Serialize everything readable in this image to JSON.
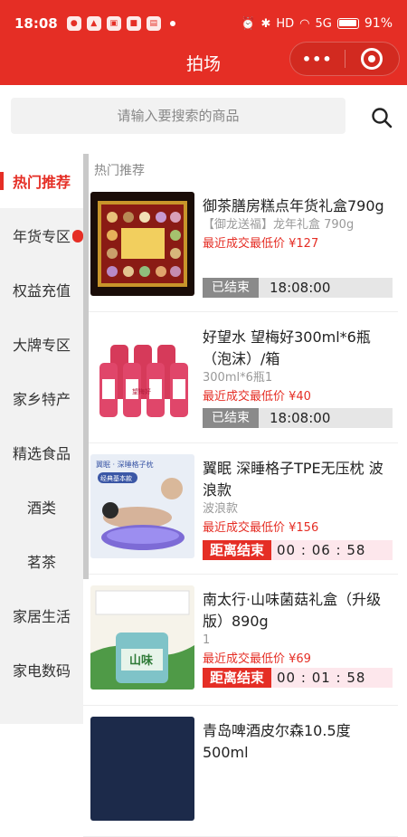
{
  "status_bar": {
    "time": "18:08",
    "battery": "91%",
    "signal": "5G",
    "hd": "HD"
  },
  "nav": {
    "title": "拍场",
    "more_icon": "•••"
  },
  "search": {
    "placeholder": "请输入要搜索的商品"
  },
  "colors": {
    "accent": "#e52e25",
    "ended_tag": "#8a8a8a",
    "countdown_bg": "#fde7ec"
  },
  "sidebar": {
    "items": [
      {
        "label": "热门推荐"
      },
      {
        "label": "年货专区"
      },
      {
        "label": "权益充值"
      },
      {
        "label": "大牌专区"
      },
      {
        "label": "家乡特产"
      },
      {
        "label": "精选食品"
      },
      {
        "label": "酒类"
      },
      {
        "label": "茗茶"
      },
      {
        "label": "家居生活"
      },
      {
        "label": "家电数码"
      }
    ]
  },
  "section": {
    "title": "热门推荐"
  },
  "products": [
    {
      "name": "御茶膳房糕点年货礼盒790g",
      "spec": "【御龙送福】龙年礼盒 790g",
      "price": "最近成交最低价 ¥127",
      "status": "已结束",
      "time": "18:08:00"
    },
    {
      "name": "好望水 望梅好300ml*6瓶（泡沫）/箱",
      "spec": "300ml*6瓶1",
      "price": "最近成交最低价 ¥40",
      "status": "已结束",
      "time": "18:08:00"
    },
    {
      "name": "翼眠 深睡格子TPE无压枕 波浪款",
      "spec": "波浪款",
      "price": "最近成交最低价 ¥156",
      "status": "距离结束",
      "time": "00 : 06 : 58"
    },
    {
      "name": "南太行·山味菌菇礼盒（升级版）890g",
      "spec": "1",
      "price": "最近成交最低价 ¥69",
      "status": "距离结束",
      "time": "00 : 01 : 58"
    },
    {
      "name": "青岛啤酒皮尔森10.5度500ml",
      "spec": "",
      "price": "",
      "status": "",
      "time": ""
    }
  ],
  "thumb_text": {
    "p2_bottle": "望梅好",
    "p3_brand": "翼眠 · 深睡格子枕",
    "p3_badge": "经典基本款",
    "p4_label": "山味"
  }
}
